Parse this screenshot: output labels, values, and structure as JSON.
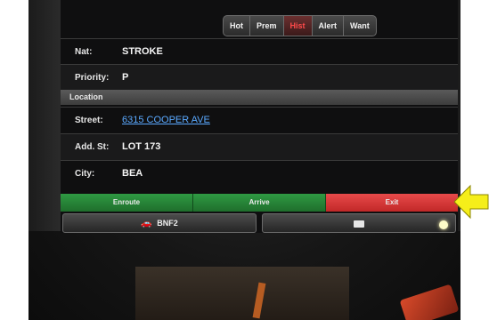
{
  "tabs": [
    {
      "label": "Hot"
    },
    {
      "label": "Prem"
    },
    {
      "label": "Hist",
      "active": true
    },
    {
      "label": "Alert"
    },
    {
      "label": "Want"
    }
  ],
  "fields": {
    "nat": {
      "label": "Nat:",
      "value": "STROKE"
    },
    "priority": {
      "label": "Priority:",
      "value": "P"
    },
    "section": "Location",
    "street": {
      "label": "Street:",
      "value": "6315 COOPER AVE"
    },
    "add_st": {
      "label": "Add. St:",
      "value": "LOT 173"
    },
    "city": {
      "label": "City:",
      "value": "BEA"
    }
  },
  "actions": {
    "enroute": "Enroute",
    "arrive": "Arrive",
    "exit": "Exit"
  },
  "bottom": {
    "unit": "BNF2"
  },
  "colors": {
    "green": "#2a8a3c",
    "red": "#d93535",
    "link": "#5aa9ff",
    "arrow": "#f5ee1a"
  },
  "icons": [
    "vehicle-icon",
    "envelope-icon",
    "yellow-arrow-icon"
  ]
}
